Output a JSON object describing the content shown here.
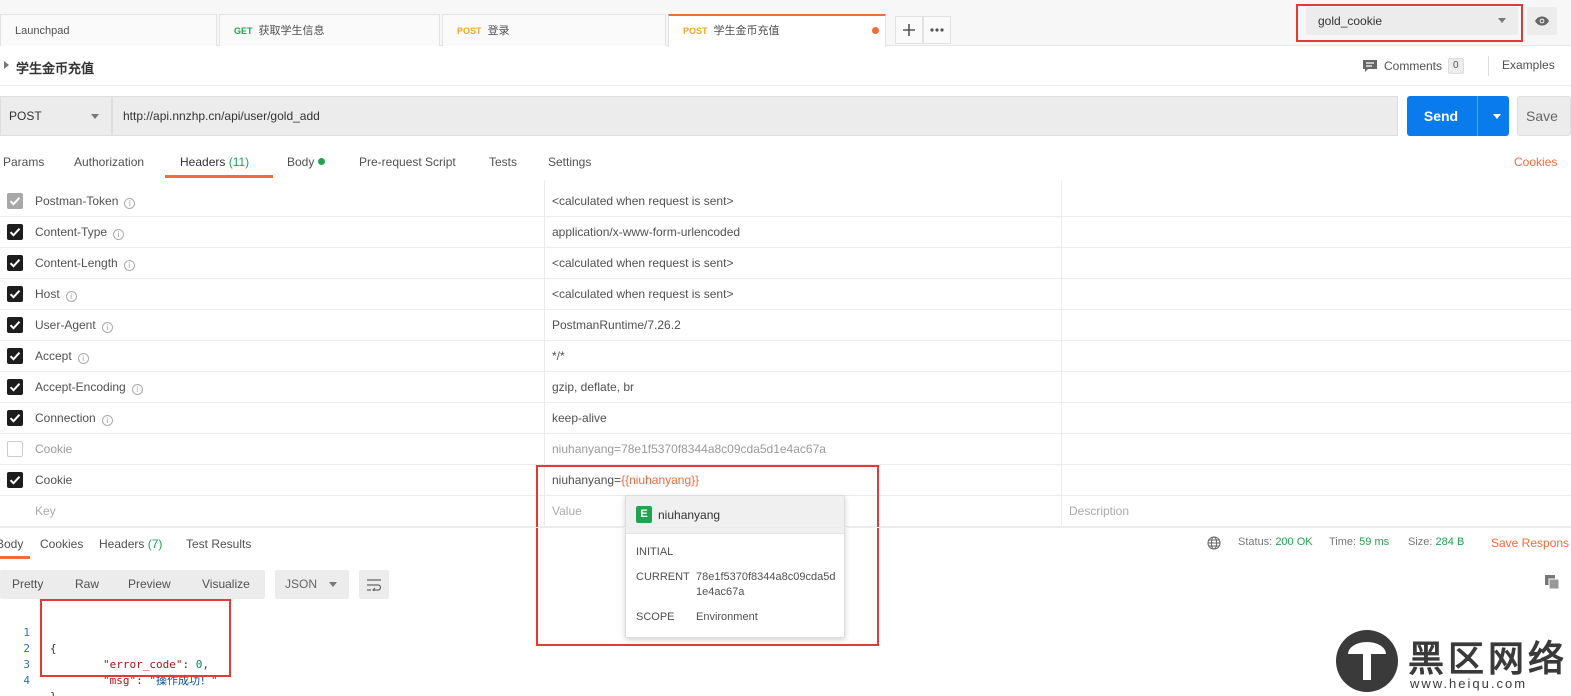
{
  "tabs": [
    {
      "method": "",
      "name": "Launchpad"
    },
    {
      "method": "GET",
      "name": "获取学生信息"
    },
    {
      "method": "POST",
      "name": "登录"
    },
    {
      "method": "POST",
      "name": "学生金币充值"
    }
  ],
  "environment": {
    "selected": "gold_cookie"
  },
  "request": {
    "title": "学生金币充值",
    "method": "POST",
    "url": "http://api.nnzhp.cn/api/user/gold_add",
    "send_label": "Send",
    "save_label": "Save"
  },
  "toolbar": {
    "comments_label": "Comments",
    "comments_count": "0",
    "examples_label": "Examples"
  },
  "subtabs": {
    "params": "Params",
    "authorization": "Authorization",
    "headers": "Headers",
    "headers_count": "(11)",
    "body": "Body",
    "prerequest": "Pre-request Script",
    "tests": "Tests",
    "settings": "Settings",
    "cookies": "Cookies"
  },
  "headers": [
    {
      "key": "Postman-Token",
      "value": "<calculated when request is sent>",
      "state": "auto",
      "info": true
    },
    {
      "key": "Content-Type",
      "value": "application/x-www-form-urlencoded",
      "state": "checked",
      "info": true
    },
    {
      "key": "Content-Length",
      "value": "<calculated when request is sent>",
      "state": "checked",
      "info": true
    },
    {
      "key": "Host",
      "value": "<calculated when request is sent>",
      "state": "checked",
      "info": true
    },
    {
      "key": "User-Agent",
      "value": "PostmanRuntime/7.26.2",
      "state": "checked",
      "info": true
    },
    {
      "key": "Accept",
      "value": "*/*",
      "state": "checked",
      "info": true
    },
    {
      "key": "Accept-Encoding",
      "value": "gzip, deflate, br",
      "state": "checked",
      "info": true
    },
    {
      "key": "Connection",
      "value": "keep-alive",
      "state": "checked",
      "info": true
    },
    {
      "key": "Cookie",
      "value": "niuhanyang=78e1f5370f8344a8c09cda5d1e4ac67a",
      "state": "unchecked",
      "info": false
    },
    {
      "key": "Cookie",
      "value_prefix": "niuhanyang=",
      "value_var": "{{niuhanyang}}",
      "state": "checked",
      "info": false
    }
  ],
  "placeholder_row": {
    "key": "Key",
    "value": "Value",
    "description": "Description"
  },
  "tooltip": {
    "badge": "E",
    "name": "niuhanyang",
    "initial_label": "INITIAL",
    "current_label": "CURRENT",
    "current_value": "78e1f5370f8344a8c09cda5d1e4ac67a",
    "scope_label": "SCOPE",
    "scope_value": "Environment"
  },
  "response": {
    "tabs": {
      "body": "Body",
      "cookies": "Cookies",
      "headers": "Headers",
      "headers_count": "(7)",
      "test_results": "Test Results"
    },
    "status_label": "Status:",
    "status_value": "200 OK",
    "time_label": "Time:",
    "time_value": "59 ms",
    "size_label": "Size:",
    "size_value": "284 B",
    "save_label": "Save Respons",
    "views": [
      "Pretty",
      "Raw",
      "Preview",
      "Visualize"
    ],
    "format": "JSON",
    "code": [
      {
        "num": "1",
        "text": "{"
      },
      {
        "num": "2",
        "key": "\"error_code\"",
        "value": "0",
        "value_type": "num",
        "trail": ","
      },
      {
        "num": "3",
        "key": "\"msg\"",
        "value": "\"操作成功！\"",
        "value_type": "str",
        "trail": ""
      },
      {
        "num": "4",
        "text": "}"
      }
    ]
  },
  "watermark": {
    "text": "黑区网络",
    "url": "www.heiqu.com"
  }
}
